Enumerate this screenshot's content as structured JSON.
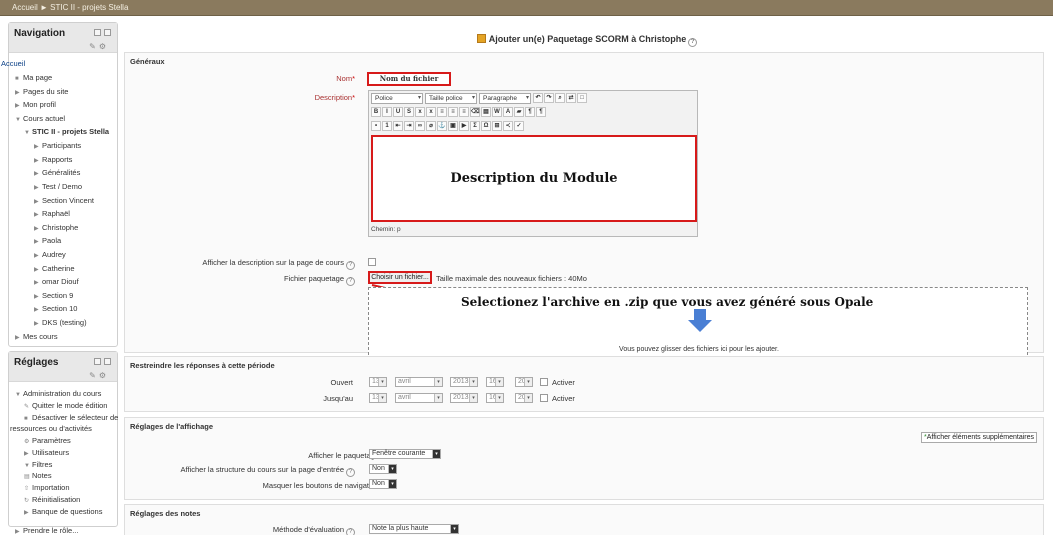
{
  "breadcrumb": "Accueil ► STIC II - projets Stella",
  "navigation": {
    "title": "Navigation",
    "items": [
      "Accueil",
      "Ma page",
      "Pages du site",
      "Mon profil",
      "Cours actuel",
      "STIC II - projets Stella",
      "Participants",
      "Rapports",
      "Généralités",
      "Test / Demo",
      "Section Vincent",
      "Raphaël",
      "Christophe",
      "Paola",
      "Audrey",
      "Catherine",
      "omar Diouf",
      "Section 9",
      "Section 10",
      "DKS (testing)",
      "Mes cours"
    ]
  },
  "reglages": {
    "title": "Réglages",
    "items": [
      "Administration du cours",
      "Quitter le mode édition",
      "Désactiver le sélecteur de",
      "ressources ou d'activités",
      "Paramètres",
      "Utilisateurs",
      "Filtres",
      "Notes",
      "Importation",
      "Réinitialisation",
      "Banque de questions",
      "Prendre le rôle..."
    ]
  },
  "page_title": "Ajouter un(e) Paquetage SCORM à Christophe",
  "generaux": {
    "legend": "Généraux",
    "name_label": "Nom",
    "name_value": "Nom du fichier",
    "desc_label": "Description",
    "toolbar": {
      "font": "Police",
      "size": "Taille police",
      "format": "Paragraphe"
    },
    "editor_text": "Description du Module",
    "editor_path": "Chemin: p",
    "show_desc_label": "Afficher la description sur la page de cours",
    "package_label": "Fichier paquetage",
    "choose_file": "Choisir un fichier...",
    "max_size": "Taille maximale des nouveaux fichiers : 40Mo",
    "annotation": "Selectionez l'archive en .zip que vous avez généré sous Opale",
    "drop_msg": "Vous pouvez glisser des fichiers ici pour les ajouter."
  },
  "restrict": {
    "legend": "Restreindre les réponses à cette période",
    "open_label": "Ouvert",
    "until_label": "Jusqu'au",
    "day": "13",
    "month": "avril",
    "year": "2013",
    "hour": "16",
    "minute": "20",
    "enable": "Activer"
  },
  "display": {
    "legend": "Réglages de l'affichage",
    "more_link": "Afficher éléments supplémentaires",
    "show_package_label": "Afficher le paquetage",
    "show_package_value": "Fenêtre courante",
    "show_structure_label": "Afficher la structure du cours sur la page d'entrée",
    "show_structure_value": "Non",
    "hide_nav_label": "Masquer les boutons de navigation",
    "hide_nav_value": "Non"
  },
  "notes": {
    "legend": "Réglages des notes",
    "method_label": "Méthode d'évaluation",
    "method_value": "Note la plus haute"
  },
  "colors": {
    "highlight": "#d71a1a",
    "breadcrumb_bar": "#8a7a5e",
    "arrow_blue": "#4a7fd4"
  }
}
